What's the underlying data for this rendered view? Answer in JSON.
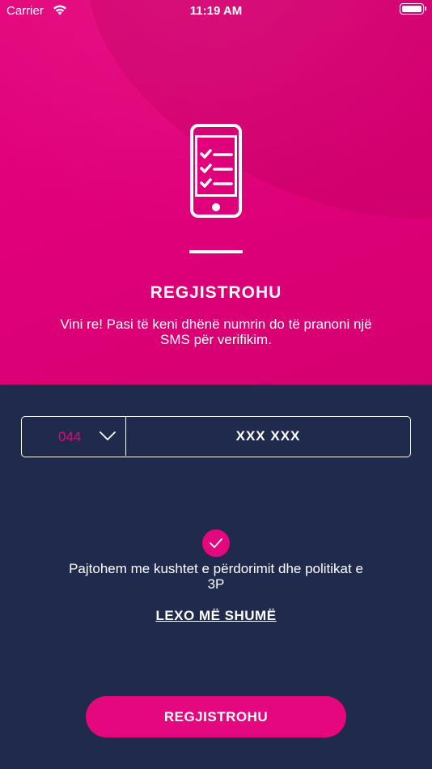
{
  "status_bar": {
    "carrier": "Carrier",
    "time": "11:19 AM",
    "wifi_icon": "wifi-icon",
    "battery_icon": "battery-icon"
  },
  "header": {
    "icon": "phone-checklist-icon",
    "title": "REGJISTROHU",
    "subtitle": "Vini re! Pasi të keni dhënë numrin do të pranoni një SMS për verifikim."
  },
  "form": {
    "prefix": "044",
    "prefix_icon": "chevron-down-icon",
    "number_placeholder": "XXX XXX",
    "number_value": ""
  },
  "consent": {
    "checked": true,
    "check_icon": "checkmark-icon",
    "text": "Pajtohem me kushtet e përdorimit dhe politikat e 3P",
    "read_more": "LEXO MË SHUMË"
  },
  "actions": {
    "submit_label": "REGJISTROHU"
  },
  "colors": {
    "accent": "#e4077d",
    "background": "#1f2a4d"
  }
}
